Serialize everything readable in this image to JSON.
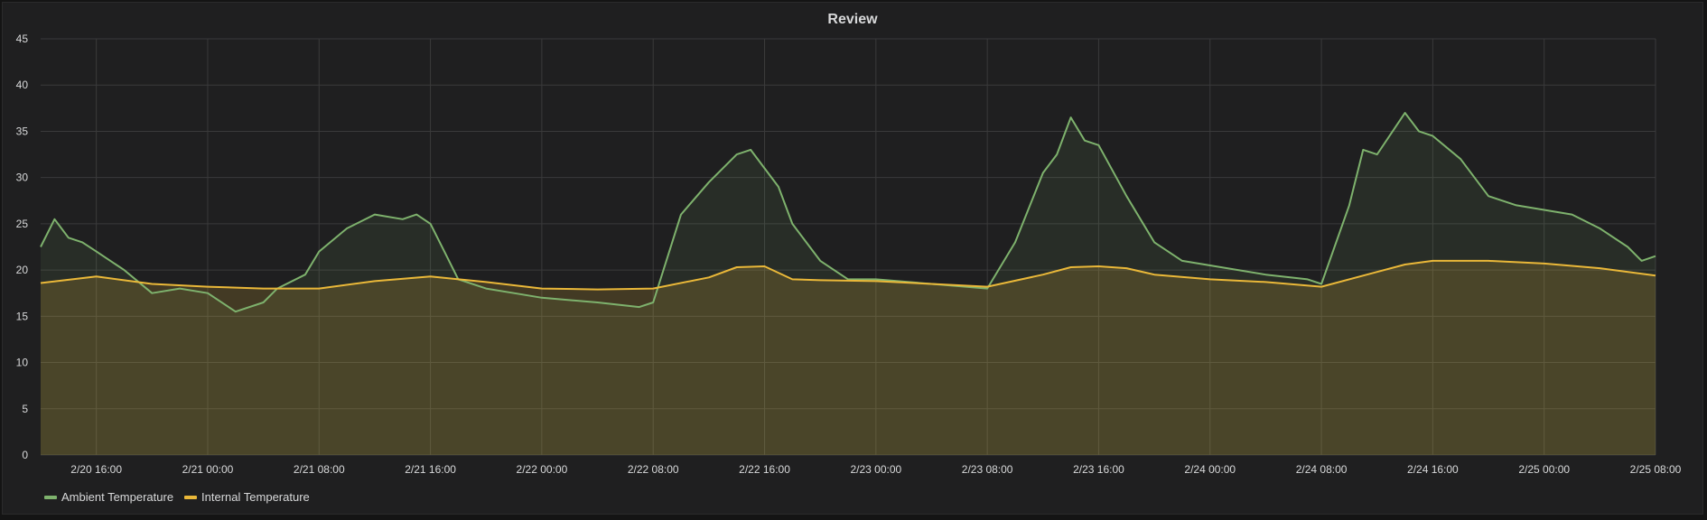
{
  "panel": {
    "title": "Review"
  },
  "chart_data": {
    "type": "area",
    "title": "Review",
    "xlabel": "",
    "ylabel": "",
    "ylim": [
      0,
      45
    ],
    "yticks": [
      0,
      5,
      10,
      15,
      20,
      25,
      30,
      35,
      40,
      45
    ],
    "xlim": [
      "2/20 12:00",
      "2/25 08:00"
    ],
    "xticks": [
      "2/20 16:00",
      "2/21 00:00",
      "2/21 08:00",
      "2/21 16:00",
      "2/22 00:00",
      "2/22 08:00",
      "2/22 16:00",
      "2/23 00:00",
      "2/23 08:00",
      "2/23 16:00",
      "2/24 00:00",
      "2/24 08:00",
      "2/24 16:00",
      "2/25 00:00",
      "2/25 08:00"
    ],
    "grid": true,
    "legend_position": "bottom-left",
    "colors": {
      "background": "#1f1f20",
      "grid": "#3a3a3b",
      "text": "#d8d9da"
    },
    "series": [
      {
        "name": "Ambient Temperature",
        "color": "#7eb26d",
        "x": [
          "2/20 12:00",
          "2/20 13:00",
          "2/20 14:00",
          "2/20 15:00",
          "2/20 16:00",
          "2/20 18:00",
          "2/20 20:00",
          "2/20 22:00",
          "2/21 00:00",
          "2/21 02:00",
          "2/21 04:00",
          "2/21 05:00",
          "2/21 07:00",
          "2/21 08:00",
          "2/21 10:00",
          "2/21 12:00",
          "2/21 14:00",
          "2/21 15:00",
          "2/21 16:00",
          "2/21 17:00",
          "2/21 18:00",
          "2/21 20:00",
          "2/21 22:00",
          "2/22 00:00",
          "2/22 04:00",
          "2/22 07:00",
          "2/22 08:00",
          "2/22 10:00",
          "2/22 12:00",
          "2/22 14:00",
          "2/22 15:00",
          "2/22 16:00",
          "2/22 17:00",
          "2/22 18:00",
          "2/22 20:00",
          "2/22 22:00",
          "2/23 00:00",
          "2/23 04:00",
          "2/23 08:00",
          "2/23 10:00",
          "2/23 12:00",
          "2/23 13:00",
          "2/23 14:00",
          "2/23 15:00",
          "2/23 16:00",
          "2/23 18:00",
          "2/23 20:00",
          "2/23 22:00",
          "2/24 00:00",
          "2/24 04:00",
          "2/24 07:00",
          "2/24 08:00",
          "2/24 10:00",
          "2/24 11:00",
          "2/24 12:00",
          "2/24 14:00",
          "2/24 15:00",
          "2/24 16:00",
          "2/24 18:00",
          "2/24 20:00",
          "2/24 22:00",
          "2/25 00:00",
          "2/25 02:00",
          "2/25 04:00",
          "2/25 06:00",
          "2/25 07:00",
          "2/25 08:00"
        ],
        "values": [
          22.5,
          25.5,
          23.5,
          23.0,
          22.0,
          20.0,
          17.5,
          18.0,
          17.5,
          15.5,
          16.5,
          18.0,
          19.5,
          22.0,
          24.5,
          26.0,
          25.5,
          26.0,
          25.0,
          22.0,
          19.0,
          18.0,
          17.5,
          17.0,
          16.5,
          16.0,
          16.5,
          26.0,
          29.5,
          32.5,
          33.0,
          31.0,
          29.0,
          25.0,
          21.0,
          19.0,
          19.0,
          18.5,
          18.0,
          23.0,
          30.5,
          32.5,
          36.5,
          34.0,
          33.5,
          28.0,
          23.0,
          21.0,
          20.5,
          19.5,
          19.0,
          18.5,
          27.0,
          33.0,
          32.5,
          37.0,
          35.0,
          34.5,
          32.0,
          28.0,
          27.0,
          26.5,
          26.0,
          24.5,
          22.5,
          21.0,
          21.5
        ]
      },
      {
        "name": "Internal Temperature",
        "color": "#eab839",
        "x": [
          "2/20 12:00",
          "2/20 16:00",
          "2/20 20:00",
          "2/21 00:00",
          "2/21 04:00",
          "2/21 08:00",
          "2/21 12:00",
          "2/21 16:00",
          "2/21 20:00",
          "2/22 00:00",
          "2/22 04:00",
          "2/22 08:00",
          "2/22 12:00",
          "2/22 14:00",
          "2/22 16:00",
          "2/22 18:00",
          "2/22 20:00",
          "2/23 00:00",
          "2/23 04:00",
          "2/23 08:00",
          "2/23 12:00",
          "2/23 14:00",
          "2/23 16:00",
          "2/23 18:00",
          "2/23 20:00",
          "2/24 00:00",
          "2/24 04:00",
          "2/24 08:00",
          "2/24 12:00",
          "2/24 14:00",
          "2/24 16:00",
          "2/24 20:00",
          "2/25 00:00",
          "2/25 04:00",
          "2/25 08:00"
        ],
        "values": [
          18.6,
          19.3,
          18.5,
          18.2,
          18.0,
          18.0,
          18.8,
          19.3,
          18.7,
          18.0,
          17.9,
          18.0,
          19.2,
          20.3,
          20.4,
          19.0,
          18.9,
          18.8,
          18.5,
          18.2,
          19.5,
          20.3,
          20.4,
          20.2,
          19.5,
          19.0,
          18.7,
          18.2,
          19.8,
          20.6,
          21.0,
          21.0,
          20.7,
          20.2,
          19.4
        ]
      }
    ]
  }
}
